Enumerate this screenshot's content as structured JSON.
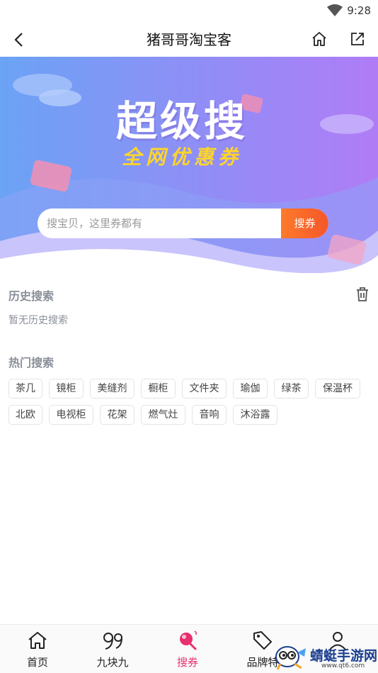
{
  "status_bar": {
    "time": "9:28"
  },
  "header": {
    "title": "猪哥哥淘宝客"
  },
  "banner": {
    "headline": "超级搜",
    "subline": "全网优惠券",
    "search_placeholder": "搜宝贝，这里券都有",
    "search_button": "搜券"
  },
  "history": {
    "title": "历史搜索",
    "empty_text": "暂无历史搜索"
  },
  "hot": {
    "title": "热门搜索",
    "tags": [
      "茶几",
      "镜柜",
      "美缝剂",
      "橱柜",
      "文件夹",
      "瑜伽",
      "绿茶",
      "保温杯",
      "北欧",
      "电视柜",
      "花架",
      "燃气灶",
      "音响",
      "沐浴露"
    ]
  },
  "bottom_nav": {
    "items": [
      {
        "label": "首页",
        "icon": "home-icon"
      },
      {
        "label": "九块九",
        "icon": "nine-nine-icon"
      },
      {
        "label": "搜券",
        "icon": "search-coupon-icon"
      },
      {
        "label": "品牌特",
        "icon": "tag-icon"
      },
      {
        "label": "",
        "icon": "profile-icon"
      }
    ],
    "active_index": 2
  },
  "watermark": {
    "text": "蜻蜓手游网",
    "url": "www.qt6.com"
  },
  "colors": {
    "accent": "#e8306f",
    "search_button": "#f5572a",
    "banner_start": "#6ba3f5",
    "banner_end": "#b07cf6",
    "subline": "#ffd52a"
  }
}
